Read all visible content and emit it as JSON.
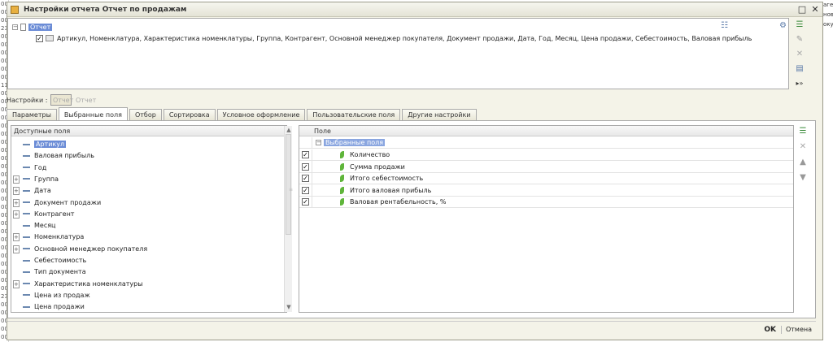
{
  "background": {
    "left_values": [
      "00",
      "00",
      "00",
      "23",
      "00",
      "00",
      "00",
      "00",
      "00",
      "00",
      "11",
      "00",
      "00",
      "00",
      "00",
      "00",
      "00",
      "00",
      "00",
      "00",
      "00",
      "00",
      "00",
      "00",
      "00",
      "00",
      "00",
      "00",
      "00",
      "00",
      "00",
      "00",
      "00",
      "00",
      "00",
      "00",
      "23",
      "00",
      "00",
      "00",
      "00",
      "00"
    ],
    "right_values": [
      "аге",
      "нов",
      "окум"
    ]
  },
  "window": {
    "title": "Настройки отчета  Отчет по продажам",
    "maximize_glyph": "□",
    "close_glyph": "✕"
  },
  "report_structure": {
    "root_label": "Отчет",
    "fields_line": "Артикул, Номенклатура, Характеристика номенклатуры, Группа, Контрагент, Основной менеджер покупателя, Документ продажи, Дата, Год, Месяц, Цена продажи, Себестоимость, Валовая прибыль"
  },
  "settings": {
    "label": "Настройки :",
    "selected": "Отчет",
    "secondary": "Отчет"
  },
  "tabs": [
    {
      "label": "Параметры",
      "active": false
    },
    {
      "label": "Выбранные поля",
      "active": true
    },
    {
      "label": "Отбор",
      "active": false
    },
    {
      "label": "Сортировка",
      "active": false
    },
    {
      "label": "Условное оформление",
      "active": false
    },
    {
      "label": "Пользовательские поля",
      "active": false
    },
    {
      "label": "Другие настройки",
      "active": false
    }
  ],
  "available_fields": {
    "header": "Доступные поля",
    "items": [
      {
        "label": "Артикул",
        "expandable": false,
        "selected": true
      },
      {
        "label": "Валовая прибыль",
        "expandable": false,
        "selected": false
      },
      {
        "label": "Год",
        "expandable": false,
        "selected": false
      },
      {
        "label": "Группа",
        "expandable": true,
        "selected": false
      },
      {
        "label": "Дата",
        "expandable": true,
        "selected": false
      },
      {
        "label": "Документ продажи",
        "expandable": true,
        "selected": false
      },
      {
        "label": "Контрагент",
        "expandable": true,
        "selected": false
      },
      {
        "label": "Месяц",
        "expandable": false,
        "selected": false
      },
      {
        "label": "Номенклатура",
        "expandable": true,
        "selected": false
      },
      {
        "label": "Основной менеджер покупателя",
        "expandable": true,
        "selected": false
      },
      {
        "label": "Себестоимость",
        "expandable": false,
        "selected": false
      },
      {
        "label": "Тип документа",
        "expandable": false,
        "selected": false
      },
      {
        "label": "Характеристика номенклатуры",
        "expandable": true,
        "selected": false
      },
      {
        "label": "Цена из продаж",
        "expandable": false,
        "selected": false
      },
      {
        "label": "Цена продажи",
        "expandable": false,
        "selected": false
      }
    ]
  },
  "selected_fields": {
    "header": "Поле",
    "group_label": "Выбранные поля",
    "items": [
      {
        "label": "Количество",
        "checked": true
      },
      {
        "label": "Сумма продажи",
        "checked": true
      },
      {
        "label": "Итого себестоимость",
        "checked": true
      },
      {
        "label": "Итого валовая прибыль",
        "checked": true
      },
      {
        "label": "Валовая рентабельность, %",
        "checked": true
      }
    ]
  },
  "footer": {
    "ok_label": "OK",
    "cancel_label": "Отмена"
  }
}
